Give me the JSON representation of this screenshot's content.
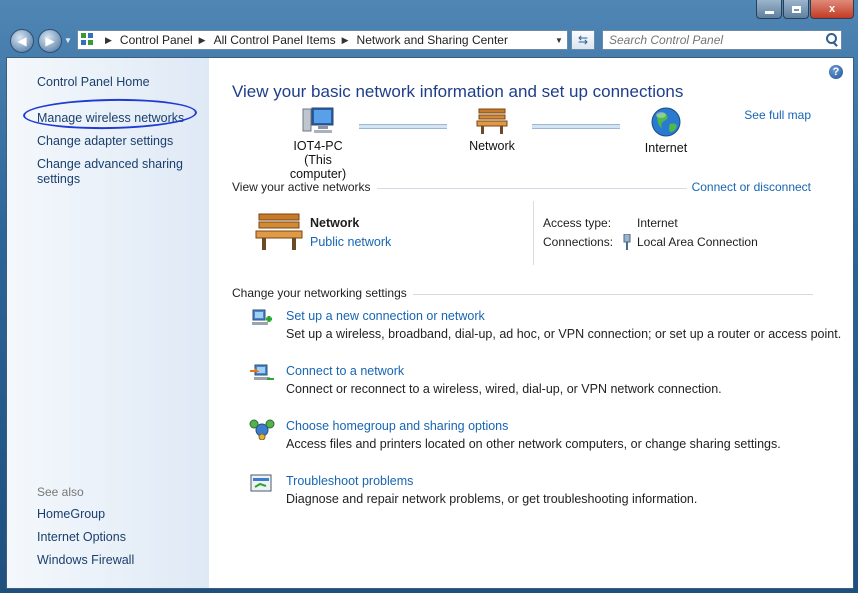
{
  "window": {
    "controls": {
      "minimize": "minimize",
      "maximize": "maximize",
      "close": "x"
    }
  },
  "address": {
    "crumbs": [
      "Control Panel",
      "All Control Panel Items",
      "Network and Sharing Center"
    ],
    "search_placeholder": "Search Control Panel"
  },
  "sidebar": {
    "items": [
      "Control Panel Home",
      "Manage wireless networks",
      "Change adapter settings",
      "Change advanced sharing settings"
    ],
    "see_also_label": "See also",
    "see_also": [
      "HomeGroup",
      "Internet Options",
      "Windows Firewall"
    ]
  },
  "main": {
    "headline": "View your basic network information and set up connections",
    "see_full_map": "See full map",
    "map": {
      "computer_name": "IOT4-PC",
      "computer_sub": "(This computer)",
      "network": "Network",
      "internet": "Internet"
    },
    "active": {
      "label": "View your active networks",
      "connect_link": "Connect or disconnect",
      "network_name": "Network",
      "network_type": "Public network",
      "access_type_key": "Access type:",
      "access_type_val": "Internet",
      "connections_key": "Connections:",
      "connections_val": "Local Area Connection"
    },
    "settings": {
      "label": "Change your networking settings",
      "tasks": [
        {
          "title": "Set up a new connection or network",
          "desc": "Set up a wireless, broadband, dial-up, ad hoc, or VPN connection; or set up a router or access point."
        },
        {
          "title": "Connect to a network",
          "desc": "Connect or reconnect to a wireless, wired, dial-up, or VPN network connection."
        },
        {
          "title": "Choose homegroup and sharing options",
          "desc": "Access files and printers located on other network computers, or change sharing settings."
        },
        {
          "title": "Troubleshoot problems",
          "desc": "Diagnose and repair network problems, or get troubleshooting information."
        }
      ]
    }
  },
  "colors": {
    "link": "#1765b3",
    "headline": "#1e3e8a",
    "annotation": "#1f3bd1"
  }
}
